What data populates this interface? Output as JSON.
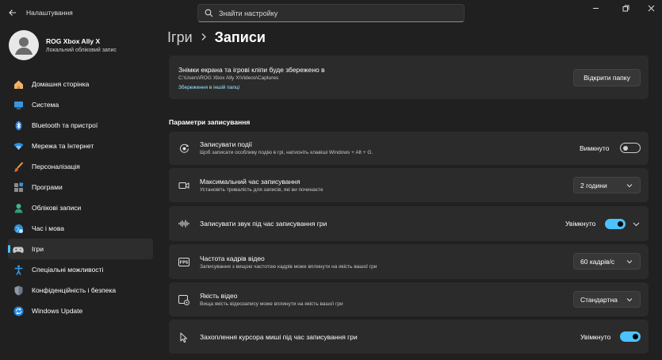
{
  "window": {
    "app_title": "Налаштування",
    "search_placeholder": "Знайти настройку",
    "controls": [
      "minimize",
      "maximize",
      "close"
    ]
  },
  "profile": {
    "name": "ROG Xbox Ally X",
    "account_type": "Локальний обліковий запис"
  },
  "sidebar": {
    "items": [
      {
        "label": "Домашня сторінка",
        "icon": "home-icon"
      },
      {
        "label": "Система",
        "icon": "system-icon"
      },
      {
        "label": "Bluetooth та пристрої",
        "icon": "bluetooth-icon"
      },
      {
        "label": "Мережа та Інтернет",
        "icon": "wifi-icon"
      },
      {
        "label": "Персоналізація",
        "icon": "brush-icon"
      },
      {
        "label": "Програми",
        "icon": "apps-icon"
      },
      {
        "label": "Облікові записи",
        "icon": "accounts-icon"
      },
      {
        "label": "Час і мова",
        "icon": "globe-icon"
      },
      {
        "label": "Ігри",
        "icon": "gamepad-icon",
        "active": true
      },
      {
        "label": "Спеціальні можливості",
        "icon": "accessibility-icon"
      },
      {
        "label": "Конфіденційність і безпека",
        "icon": "shield-icon"
      },
      {
        "label": "Windows Update",
        "icon": "update-icon"
      }
    ]
  },
  "breadcrumb": {
    "parent": "Ігри",
    "current": "Записи"
  },
  "save_location": {
    "title": "Знімки екрана та ігрові кліпи буде збережено в",
    "path": "C:\\Users\\ROG Xbox Ally X\\Videos\\Captures",
    "link": "Збереження в іншій папці",
    "button": "Відкрити папку"
  },
  "recording": {
    "section_title": "Параметри записування",
    "record_events": {
      "title": "Записувати події",
      "description": "Щоб записати особливу подію в грі, натисніть клавіші Windows + Alt + G.",
      "state_label": "Вимкнуто",
      "on": false
    },
    "max_time": {
      "title": "Максимальний час записування",
      "description": "Установіть тривалість для записів, які ви починаєте",
      "value": "2 години"
    },
    "record_audio": {
      "title": "Записувати звук під час записування гри",
      "state_label": "Увімкнуто",
      "on": true
    },
    "frame_rate": {
      "title": "Частота кадрів відео",
      "description": "Записування з вищою частотою кадрів може вплинути на якість вашої гри",
      "value": "60 кадрів/с"
    },
    "video_quality": {
      "title": "Якість відео",
      "description": "Вища якість відеозапису може вплинути на якість вашої гри",
      "value": "Стандартна"
    },
    "mouse_cursor": {
      "title": "Захоплення курсора миші під час записування гри",
      "state_label": "Увімкнуто",
      "on": true
    }
  },
  "colors": {
    "background": "#202020",
    "card": "#2b2b2b",
    "accent": "#4cc2ff",
    "link": "#99ebff"
  }
}
